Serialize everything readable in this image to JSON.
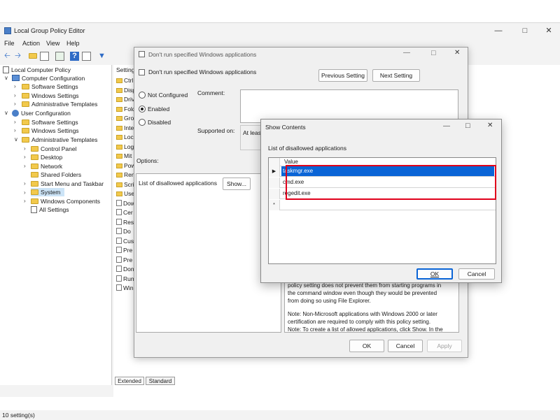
{
  "main_window": {
    "title": "Local Group Policy Editor",
    "menu": [
      "File",
      "Action",
      "View",
      "Help"
    ],
    "status": "10 setting(s)"
  },
  "tree": {
    "root": "Local Computer Policy",
    "computer_config": "Computer Configuration",
    "cc_software": "Software Settings",
    "cc_windows": "Windows Settings",
    "cc_admin": "Administrative Templates",
    "user_config": "User Configuration",
    "uc_software": "Software Settings",
    "uc_windows": "Windows Settings",
    "uc_admin": "Administrative Templates",
    "control_panel": "Control Panel",
    "desktop": "Desktop",
    "network": "Network",
    "shared_folders": "Shared Folders",
    "start_menu": "Start Menu and Taskbar",
    "system": "System",
    "windows_components": "Windows Components",
    "all_settings": "All Settings"
  },
  "right_pane": {
    "header": "Setting",
    "items": [
      "Ctrl",
      "Disp",
      "Driv",
      "Fold",
      "Gro",
      "Inte",
      "Loc",
      "Log",
      "Mit",
      "Pow",
      "Ren",
      "Scri",
      "Use",
      "Dow",
      "Cer",
      "Res",
      "Do",
      "Cus",
      "Pre",
      "Pre",
      "Don",
      "Run",
      "Win"
    ],
    "tabs": [
      "Extended",
      "Standard"
    ]
  },
  "policy_dialog": {
    "window_title": "Don't run specified Windows applications",
    "heading": "Don't run specified Windows applications",
    "prev_button": "Previous Setting",
    "next_button": "Next Setting",
    "radio_not_configured": "Not Configured",
    "radio_enabled": "Enabled",
    "radio_disabled": "Disabled",
    "comment_label": "Comment:",
    "supported_label": "Supported on:",
    "supported_value": "At leas",
    "options_label": "Options:",
    "list_label": "List of disallowed applications",
    "show_button": "Show...",
    "help_line1": "policy setting does not prevent them from starting programs in",
    "help_line2": "the command window even though they would be prevented",
    "help_line3": "from doing so using File Explorer.",
    "help_line4": "Note: Non-Microsoft applications with Windows 2000 or later",
    "help_line5": "certification are required to comply with this policy setting.",
    "help_line6": "Note: To create a list of allowed applications, click Show.  In the",
    "ok_button": "OK",
    "cancel_button": "Cancel",
    "apply_button": "Apply"
  },
  "show_dialog": {
    "title": "Show Contents",
    "list_label": "List of disallowed applications",
    "column_header": "Value",
    "rows": [
      "taskmgr.exe",
      "cmd.exe",
      "regedit.exe"
    ],
    "new_row_marker": "*",
    "ok_button": "OK",
    "cancel_button": "Cancel"
  },
  "colors": {
    "selection": "#0a64d6",
    "highlight_border": "#e0001b",
    "folder": "#f2c94c"
  }
}
